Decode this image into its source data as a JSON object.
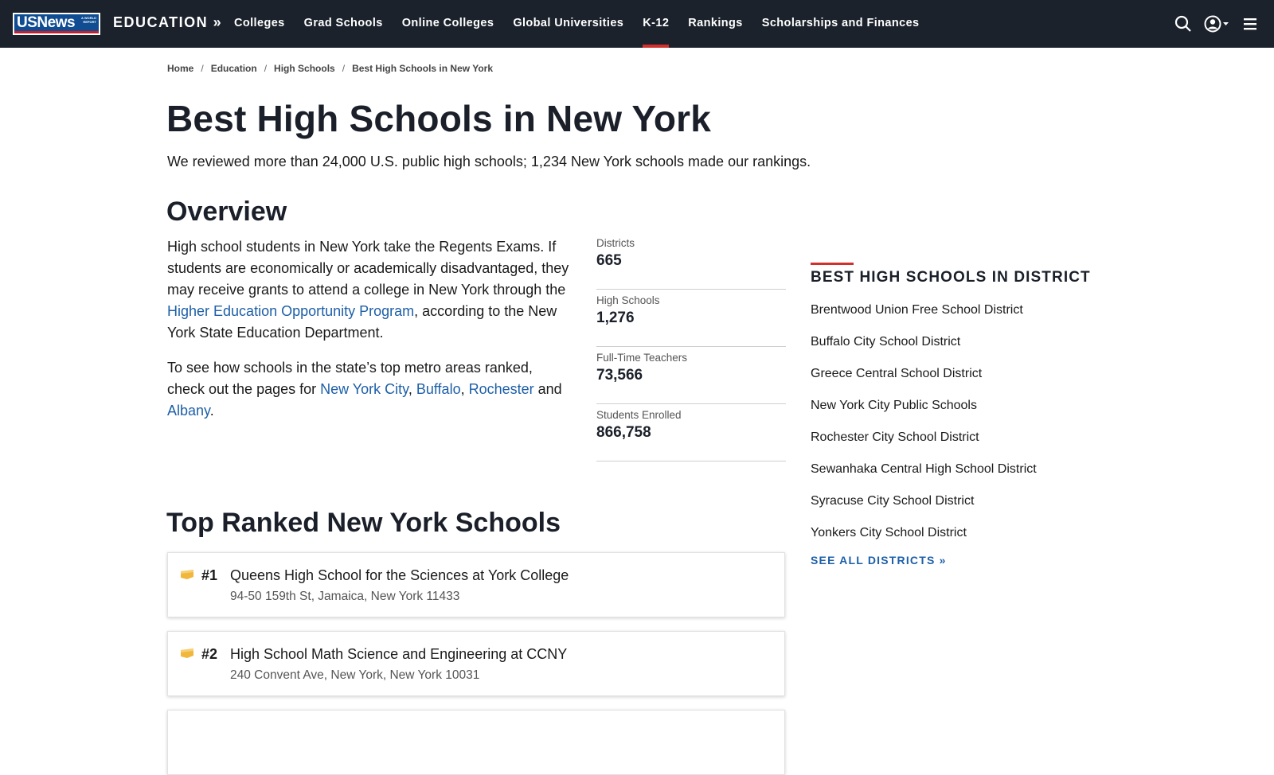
{
  "nav": {
    "logo_text": "USNews",
    "logo_sub": "A WORLD REPORT",
    "brand": "EDUCATION »",
    "links": [
      "Colleges",
      "Grad Schools",
      "Online Colleges",
      "Global Universities",
      "K-12",
      "Rankings",
      "Scholarships and Finances"
    ],
    "active_link": "K-12",
    "icons": [
      "search-icon",
      "account-icon",
      "menu-icon"
    ]
  },
  "breadcrumb": [
    "Home",
    "Education",
    "High Schools",
    "Best High Schools in New York"
  ],
  "breadcrumb_sep": "/",
  "page": {
    "title": "Best High Schools in New York",
    "subtitle": "We reviewed more than 24,000 U.S. public high schools; 1,234 New York schools made our rankings."
  },
  "overview": {
    "heading": "Overview",
    "p1_a": "High school students in New York take the Regents Exams. If students are economically or academically disadvantaged, they may receive grants to attend a college in New York through the ",
    "p1_link": "Higher Education Opportunity Program",
    "p1_b": ", according to the New York State Education Department.",
    "p2_a": "To see how schools in the state’s top metro areas ranked, check out the pages for ",
    "p2_link1": "New York City",
    "p2_c1": ", ",
    "p2_link2": "Buffalo",
    "p2_c2": ", ",
    "p2_link3": "Rochester",
    "p2_and": " and ",
    "p2_link4": "Albany",
    "p2_end": "."
  },
  "stats": [
    {
      "label": "Districts",
      "value": "665"
    },
    {
      "label": "High Schools",
      "value": "1,276"
    },
    {
      "label": "Full-Time Teachers",
      "value": "73,566"
    },
    {
      "label": "Students Enrolled",
      "value": "866,758"
    }
  ],
  "districts": {
    "title": "BEST HIGH SCHOOLS IN DISTRICT",
    "items": [
      "Brentwood Union Free School District",
      "Buffalo City School District",
      "Greece Central School District",
      "New York City Public Schools",
      "Rochester City School District",
      "Sewanhaka Central High School District",
      "Syracuse City School District",
      "Yonkers City School District"
    ],
    "see_all": "SEE ALL DISTRICTS »"
  },
  "top_ranked": {
    "heading": "Top Ranked New York Schools",
    "schools": [
      {
        "rank": "#1",
        "name": "Queens High School for the Sciences at York College",
        "address": "94-50 159th St, Jamaica, New York 11433"
      },
      {
        "rank": "#2",
        "name": "High School Math Science and Engineering at CCNY",
        "address": "240 Convent Ave, New York, New York 10031"
      }
    ]
  },
  "colors": {
    "nav_bg": "#1b222c",
    "accent_red": "#d0312d",
    "link_blue": "#1d5fa8",
    "medal_gold": "#f1b63c"
  }
}
